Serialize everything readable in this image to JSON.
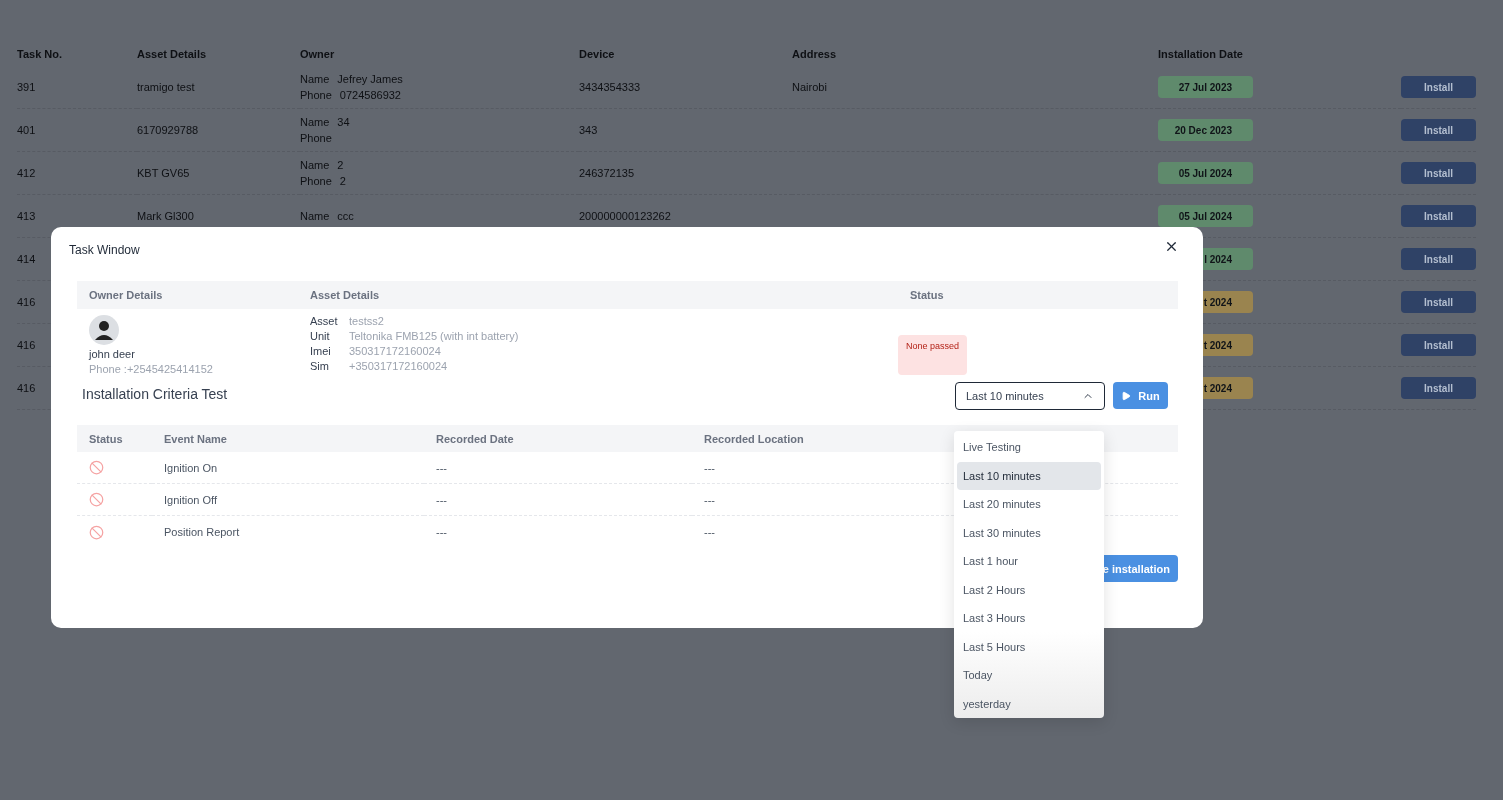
{
  "background_table": {
    "columns": [
      "Task No.",
      "Asset Details",
      "Owner",
      "Device",
      "Address",
      "Installation Date"
    ],
    "rows": [
      {
        "task_no": "391",
        "asset": "tramigo test",
        "owner": [
          {
            "label": "Name",
            "value": "Jefrey James"
          },
          {
            "label": "Phone",
            "value": "0724586932"
          }
        ],
        "device": "3434354333",
        "address": "Nairobi",
        "install_date": "27 Jul 2023",
        "color": "#5f8a6c",
        "button": "Install"
      },
      {
        "task_no": "401",
        "asset": "6170929788",
        "owner": [
          {
            "label": "Name",
            "value": "34"
          },
          {
            "label": "Phone"
          }
        ],
        "device": "343",
        "install_date": "20 Dec 2023",
        "color": "#5f8a6c",
        "button": "Install"
      },
      {
        "task_no": "412",
        "asset": "KBT GV65",
        "owner": [
          {
            "label": "Name",
            "value": "2"
          },
          {
            "label": "Phone",
            "value": "2"
          }
        ],
        "device": "246372135",
        "install_date": "05 Jul 2024",
        "color": "#5f8a6c",
        "button": "Install"
      },
      {
        "task_no": "413",
        "asset": "Mark Gl300",
        "owner": [
          {
            "label": "Name",
            "value": "ccc"
          }
        ],
        "device": "200000000123262",
        "install_date": "05 Jul 2024",
        "color": "#5f8a6c",
        "button": "Install"
      },
      {
        "task_no": "414",
        "install_date": "l 2024",
        "color": "#5f8a6c",
        "button": "Install"
      },
      {
        "task_no": "416",
        "install_date": "t 2024",
        "color": "#9a844f",
        "button": "Install"
      },
      {
        "task_no": "416",
        "install_date": "t 2024",
        "color": "#9a844f",
        "button": "Install"
      },
      {
        "task_no": "416",
        "install_date": "t 2024",
        "color": "#9a844f",
        "button": "Install"
      }
    ]
  },
  "modal": {
    "title": "Task Window",
    "details": {
      "columns": [
        "Owner Details",
        "Asset Details",
        "Status"
      ],
      "owner": {
        "name": "john deer",
        "phone": "Phone :+2545425414152"
      },
      "asset": [
        {
          "label": "Asset",
          "value": "testss2"
        },
        {
          "label": "Unit",
          "value": "Teltonika FMB125 (with int battery)"
        },
        {
          "label": "Imei",
          "value": "350317172160024"
        },
        {
          "label": "Sim",
          "value": "+350317172160024"
        }
      ],
      "status": "None passed"
    },
    "test": {
      "title": "Installation Criteria Test",
      "select": {
        "value": "Last 10 minutes",
        "expanded": true
      },
      "run_button": "Run",
      "options": [
        {
          "label": "Live Testing",
          "selected": false
        },
        {
          "label": "Last 10 minutes",
          "selected": true
        },
        {
          "label": "Last 20 minutes",
          "selected": false
        },
        {
          "label": "Last 30 minutes",
          "selected": false
        },
        {
          "label": "Last 1 hour",
          "selected": false
        },
        {
          "label": "Last 2 Hours",
          "selected": false
        },
        {
          "label": "Last 3 Hours",
          "selected": false
        },
        {
          "label": "Last 5 Hours",
          "selected": false
        },
        {
          "label": "Today",
          "selected": false
        },
        {
          "label": "yesterday",
          "selected": false
        }
      ],
      "columns": [
        "Status",
        "Event Name",
        "Recorded Date",
        "Recorded Location"
      ],
      "events": [
        {
          "event": "Ignition On",
          "date": "---",
          "location": "---"
        },
        {
          "event": "Ignition Off",
          "date": "---",
          "location": "---"
        },
        {
          "event": "Position Report",
          "date": "---",
          "location": "---"
        }
      ]
    },
    "complete_button": "e installation"
  }
}
